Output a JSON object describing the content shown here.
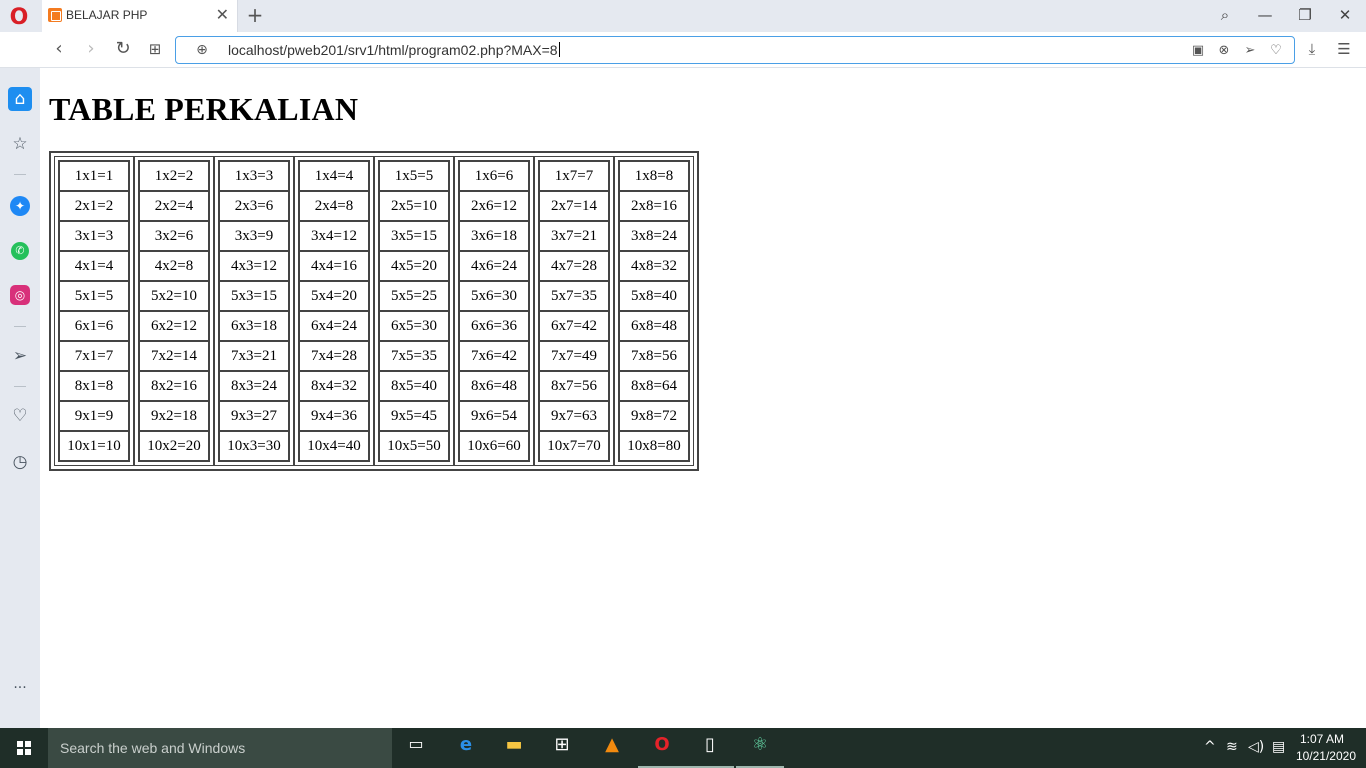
{
  "browser": {
    "tab": {
      "title": "BELAJAR PHP",
      "close": "✕"
    },
    "new_tab": "+",
    "window_controls": {
      "search": "⌕",
      "minimize": "—",
      "restore": "❐",
      "close": "✕"
    },
    "nav": {
      "back": "‹",
      "forward": "›",
      "reload": "↻",
      "tabs": "⊞"
    },
    "address": "localhost/pweb201/srv1/html/program02.php?MAX=8",
    "address_icons": [
      "camera-icon",
      "block-icon",
      "send-icon",
      "heart-icon"
    ],
    "right_icons": [
      "download-icon",
      "settings-icon"
    ]
  },
  "sidebar": {
    "items": [
      "home-icon",
      "star-icon",
      "messenger-icon",
      "whatsapp-icon",
      "instagram-icon",
      "send-icon",
      "heart-icon",
      "history-icon",
      "more-icon"
    ]
  },
  "page": {
    "title": "TABLE PERKALIAN",
    "columns": [
      [
        "1x1=1",
        "2x1=2",
        "3x1=3",
        "4x1=4",
        "5x1=5",
        "6x1=6",
        "7x1=7",
        "8x1=8",
        "9x1=9",
        "10x1=10"
      ],
      [
        "1x2=2",
        "2x2=4",
        "3x2=6",
        "4x2=8",
        "5x2=10",
        "6x2=12",
        "7x2=14",
        "8x2=16",
        "9x2=18",
        "10x2=20"
      ],
      [
        "1x3=3",
        "2x3=6",
        "3x3=9",
        "4x3=12",
        "5x3=15",
        "6x3=18",
        "7x3=21",
        "8x3=24",
        "9x3=27",
        "10x3=30"
      ],
      [
        "1x4=4",
        "2x4=8",
        "3x4=12",
        "4x4=16",
        "5x4=20",
        "6x4=24",
        "7x4=28",
        "8x4=32",
        "9x4=36",
        "10x4=40"
      ],
      [
        "1x5=5",
        "2x5=10",
        "3x5=15",
        "4x5=20",
        "5x5=25",
        "6x5=30",
        "7x5=35",
        "8x5=40",
        "9x5=45",
        "10x5=50"
      ],
      [
        "1x6=6",
        "2x6=12",
        "3x6=18",
        "4x6=24",
        "5x6=30",
        "6x6=36",
        "7x6=42",
        "8x6=48",
        "9x6=54",
        "10x6=60"
      ],
      [
        "1x7=7",
        "2x7=14",
        "3x7=21",
        "4x7=28",
        "5x7=35",
        "6x7=42",
        "7x7=49",
        "8x7=56",
        "9x7=63",
        "10x7=70"
      ],
      [
        "1x8=8",
        "2x8=16",
        "3x8=24",
        "4x8=32",
        "5x8=40",
        "6x8=48",
        "7x8=56",
        "8x8=64",
        "9x8=72",
        "10x8=80"
      ]
    ]
  },
  "taskbar": {
    "search_placeholder": "Search the web and Windows",
    "apps": [
      "task-view-icon",
      "edge-icon",
      "file-explorer-icon",
      "store-icon",
      "vlc-icon",
      "opera-icon",
      "file-icon",
      "atom-icon"
    ],
    "clock": {
      "time": "1:07 AM",
      "date": "10/21/2020"
    }
  }
}
